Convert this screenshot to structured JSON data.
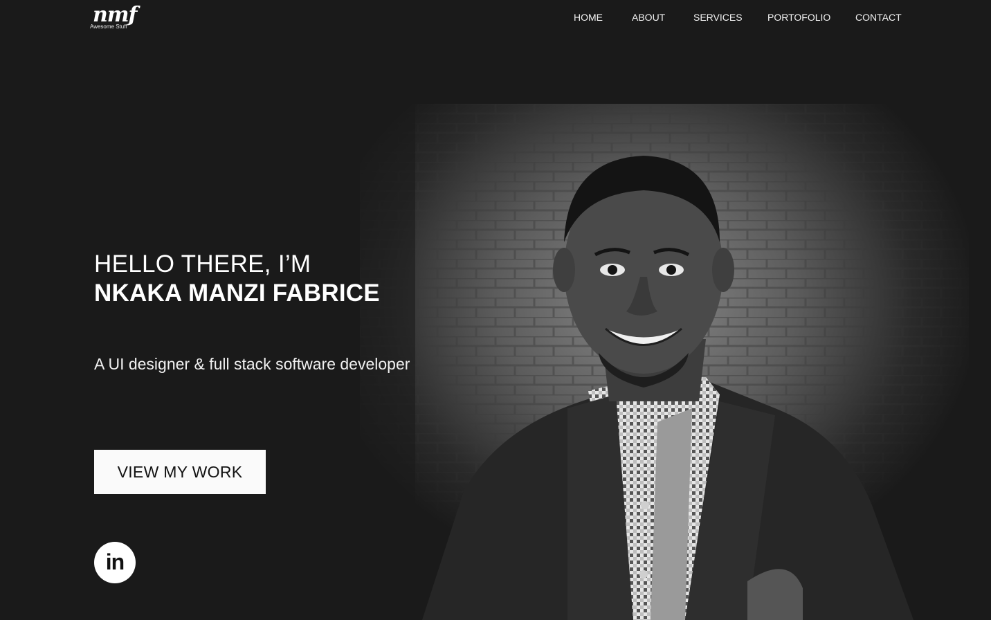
{
  "logo": {
    "mark": "nmf",
    "tagline": "Awesome Stuff"
  },
  "nav": {
    "items": [
      {
        "label": "HOME"
      },
      {
        "label": "ABOUT"
      },
      {
        "label": "SERVICES"
      },
      {
        "label": "PORTOFOLIO"
      },
      {
        "label": "CONTACT"
      }
    ]
  },
  "hero": {
    "greeting": "HELLO THERE, I’M",
    "name": "NKAKA MANZI FABRICE",
    "tagline": "A UI designer & full stack software developer",
    "cta_label": "VIEW MY WORK",
    "social": {
      "icon": "linkedin-icon",
      "glyph": "in"
    }
  },
  "colors": {
    "background": "#1a1a1a",
    "text": "#ffffff",
    "button_bg": "#fafafa",
    "button_text": "#111111"
  }
}
